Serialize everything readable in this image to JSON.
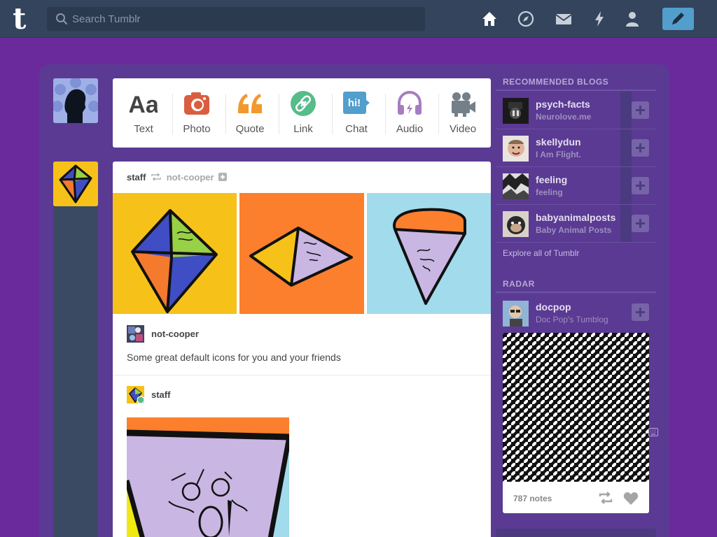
{
  "topbar": {
    "logo": "t",
    "search_placeholder": "Search Tumblr",
    "nav_icons": [
      "home-icon",
      "explore-compass-icon",
      "inbox-envelope-icon",
      "activity-lightning-icon",
      "account-person-icon"
    ],
    "compose_icon": "pencil-icon"
  },
  "post_types": [
    {
      "label": "Text",
      "icon": "text-aa-icon",
      "color": "#444444"
    },
    {
      "label": "Photo",
      "icon": "camera-icon",
      "color": "#d95e40"
    },
    {
      "label": "Quote",
      "icon": "quote-icon",
      "color": "#f2992e"
    },
    {
      "label": "Link",
      "icon": "link-icon",
      "color": "#56bc8a"
    },
    {
      "label": "Chat",
      "icon": "chat-bubble-icon",
      "color": "#529ecc"
    },
    {
      "label": "Audio",
      "icon": "headphones-icon",
      "color": "#a77dc2"
    },
    {
      "label": "Video",
      "icon": "video-camera-icon",
      "color": "#748089"
    }
  ],
  "post": {
    "poster": "staff",
    "reblogged_from": "not-cooper",
    "trail": [
      {
        "name": "not-cooper",
        "text": "Some great default icons for you and your friends"
      },
      {
        "name": "staff"
      }
    ]
  },
  "sidebar": {
    "recommended_title": "RECOMMENDED BLOGS",
    "blogs": [
      {
        "name": "psych-facts",
        "subtitle": "Neurolove.me"
      },
      {
        "name": "skellydun",
        "subtitle": "I Am Flight."
      },
      {
        "name": "feeling",
        "subtitle": "feeling"
      },
      {
        "name": "babyanimalposts",
        "subtitle": "Baby Animal Posts"
      }
    ],
    "explore_link": "Explore all of Tumblr",
    "radar_title": "RADAR",
    "radar": {
      "name": "docpop",
      "subtitle": "Doc Pop's Tumblog",
      "notes": "787 notes"
    }
  },
  "colors": {
    "background": "#6a2a9c",
    "topbar": "#33445c",
    "compose": "#529ecc"
  }
}
